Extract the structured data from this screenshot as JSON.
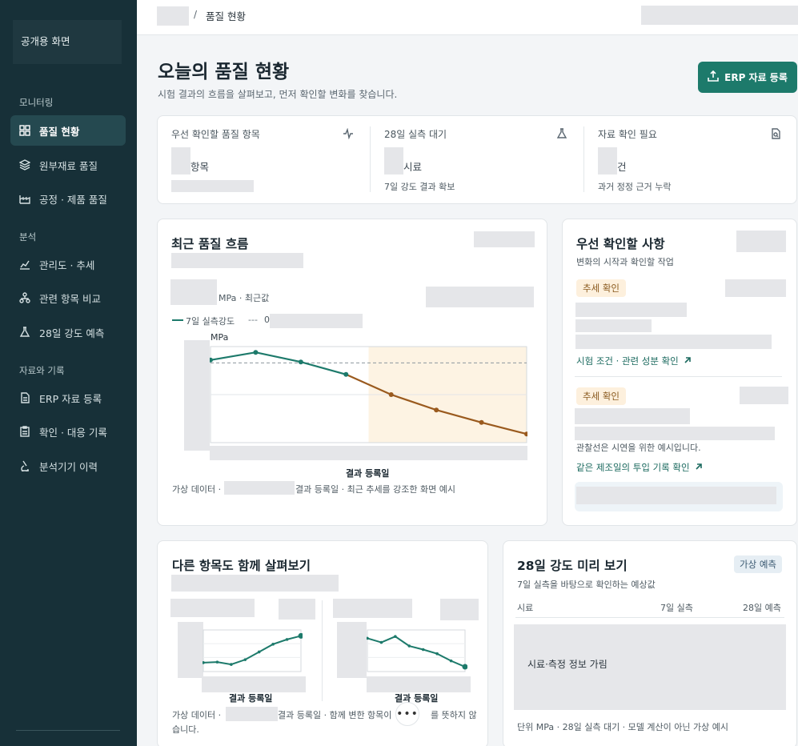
{
  "sidebar": {
    "brand": "공개용 화면",
    "sections": [
      "모니터링",
      "분석",
      "자료와 기록"
    ],
    "items": [
      {
        "label": "품질 현황",
        "icon": "grid-icon",
        "active": true
      },
      {
        "label": "원부재료 품질",
        "icon": "layers-icon"
      },
      {
        "label": "공정 · 제품 품질",
        "icon": "factory-icon"
      },
      {
        "label": "관리도 · 추세",
        "icon": "trend-chart-icon"
      },
      {
        "label": "관련 항목 비교",
        "icon": "network-icon"
      },
      {
        "label": "28일 강도 예측",
        "icon": "flask-icon"
      },
      {
        "label": "ERP 자료 등록",
        "icon": "file-icon"
      },
      {
        "label": "확인 · 대응 기록",
        "icon": "clipboard-icon"
      },
      {
        "label": "분석기기 이력",
        "icon": "microscope-icon"
      }
    ]
  },
  "topbar": {
    "separator": "/",
    "current": "품질 현황"
  },
  "header": {
    "title": "오늘의 품질 현황",
    "subtitle": "시험 결과의 흐름을 살펴보고, 먼저 확인할 변화를 찾습니다.",
    "erp_button": "ERP 자료 등록"
  },
  "kpis": [
    {
      "label": "우선 확인할 품질 항목",
      "unit": "항목",
      "note": "",
      "icon": "activity-icon"
    },
    {
      "label": "28일 실측 대기",
      "unit": "시료",
      "note": "7일 강도 결과 확보",
      "icon": "flask-icon"
    },
    {
      "label": "자료 확인 필요",
      "unit": "건",
      "note": "과거 정정 근거 누락",
      "icon": "file-search-icon"
    }
  ],
  "trend": {
    "title": "최근 품질 흐름",
    "value_unit": "MPa · 최근값",
    "legend_series": "7일 실측강도",
    "legend_ref_prefix": "0",
    "y_unit": "MPa",
    "xlabel": "결과 등록일",
    "footnote_prefix": "가상 데이터 ·",
    "footnote_suffix": "결과 등록일 · 최근 추세를 강조한 화면 예시"
  },
  "priority": {
    "title": "우선 확인할 사항",
    "subtitle": "변화의 시작과 확인할 작업",
    "items": [
      {
        "tag": "추세 확인",
        "note": "",
        "link": "시험 조건 · 관련 성분 확인"
      },
      {
        "tag": "추세 확인",
        "note": "관찰선은 시연을 위한 예시입니다.",
        "link": "같은 제조일의 투입 기록 확인"
      }
    ]
  },
  "compare": {
    "title": "다른 항목도 함께 살펴보기",
    "xlabel_left": "결과 등록일",
    "xlabel_right": "결과 등록일",
    "footnote_a": "가상 데이터 ·",
    "footnote_b": "결과 등록일 · 함께 변한 항목이",
    "footnote_c": "를 뜻하지 않",
    "footnote_d": "습니다."
  },
  "preview": {
    "title": "28일 강도 미리 보기",
    "badge": "가상 예측",
    "subtitle": "7일 실측을 바탕으로 확인하는 예상값",
    "columns": [
      "시료",
      "7일 실측",
      "28일 예측"
    ],
    "masked_text": "시료·측정 정보 가림",
    "footnote": "단위 MPa · 28일 실측 대기 · 모델 계산이 아닌 가상 예시"
  },
  "fab": "•••",
  "chart_data": [
    {
      "type": "line",
      "title": "최근 품질 흐름",
      "xlabel": "결과 등록일",
      "ylabel": "MPa",
      "series": [
        {
          "name": "7일 실측강도",
          "values": [
            8.6,
            9.4,
            8.4,
            7.1,
            5.0,
            3.4,
            2.1,
            0.9
          ]
        }
      ],
      "reference_line": 8.3,
      "ylim": [
        0,
        10
      ],
      "highlight_from_index": 4,
      "grid": true
    },
    {
      "type": "line",
      "xlabel": "결과 등록일",
      "series": [
        {
          "values": [
            1.5,
            1.6,
            1.2,
            2.0,
            3.3,
            4.6,
            5.4,
            6.0
          ]
        }
      ],
      "ylim": [
        0,
        7
      ]
    },
    {
      "type": "line",
      "xlabel": "결과 등록일",
      "series": [
        {
          "values": [
            5.6,
            4.9,
            5.9,
            4.3,
            3.7,
            3.0,
            1.8,
            0.8
          ]
        }
      ],
      "ylim": [
        0,
        7
      ]
    }
  ],
  "colors": {
    "sidebar": "#173038",
    "accent": "#1d7a6b",
    "trend": "#1d7a6b",
    "decline": "#9a5a1e",
    "highlight": "#fdf3e3"
  }
}
